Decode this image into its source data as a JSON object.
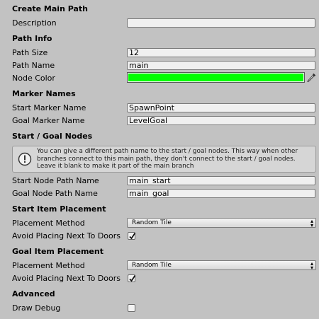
{
  "sections": {
    "create_main_path": "Create Main Path",
    "path_info": "Path Info",
    "marker_names": "Marker Names",
    "start_goal_nodes": "Start / Goal Nodes",
    "start_item_placement": "Start Item Placement",
    "goal_item_placement": "Goal Item Placement",
    "advanced": "Advanced"
  },
  "fields": {
    "description": {
      "label": "Description",
      "value": ""
    },
    "path_size": {
      "label": "Path Size",
      "value": "12"
    },
    "path_name": {
      "label": "Path Name",
      "value": "main"
    },
    "node_color": {
      "label": "Node Color",
      "color": "#00ff00"
    },
    "start_marker_name": {
      "label": "Start Marker Name",
      "value": "SpawnPoint"
    },
    "goal_marker_name": {
      "label": "Goal Marker Name",
      "value": "LevelGoal"
    },
    "start_node_path_name": {
      "label": "Start Node Path Name",
      "value": "main_start"
    },
    "goal_node_path_name": {
      "label": "Goal Node Path Name",
      "value": "main_goal"
    },
    "start_placement_method": {
      "label": "Placement Method",
      "value": "Random Tile"
    },
    "start_avoid_doors": {
      "label": "Avoid Placing Next To Doors",
      "checked": true
    },
    "goal_placement_method": {
      "label": "Placement Method",
      "value": "Random Tile"
    },
    "goal_avoid_doors": {
      "label": "Avoid Placing Next To Doors",
      "checked": true
    },
    "draw_debug": {
      "label": "Draw Debug",
      "checked": false
    }
  },
  "help_box": {
    "icon": "info-icon",
    "text": "You can give a different path name to the start / goal nodes. This way when other branches connect to this main path, they don't connect to the start / goal nodes. Leave it blank to make it part of the main branch"
  },
  "colors": {
    "background": "#c2c2c2",
    "node_color": "#00ff00"
  }
}
